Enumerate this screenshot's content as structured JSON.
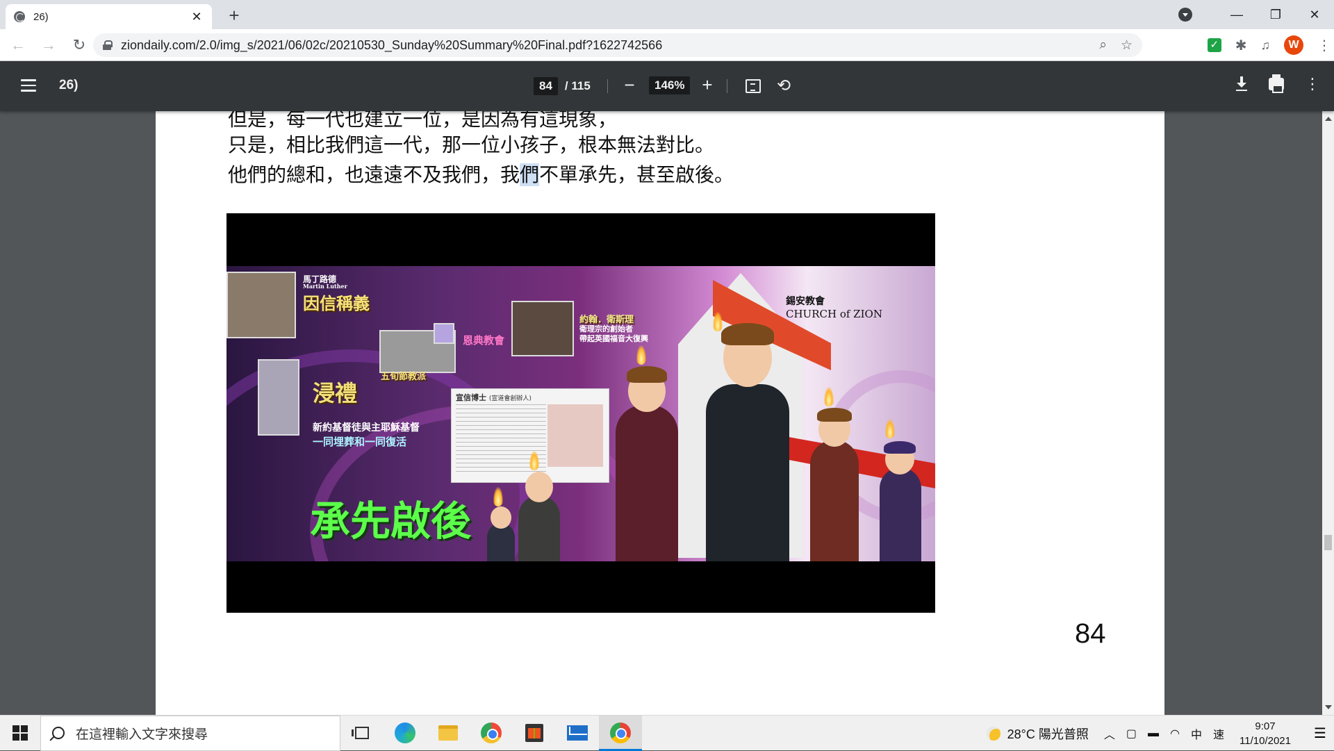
{
  "browser": {
    "tab_title": "26)",
    "url": "ziondaily.com/2.0/img_s/2021/06/02c/20210530_Sunday%20Summary%20Final.pdf?1622742566",
    "avatar_letter": "W"
  },
  "pdf": {
    "doc_title": "26)",
    "current_page": "84",
    "total_pages": "/ 115",
    "zoom": "146%"
  },
  "page": {
    "line1": "但是，每一代也建立一位，是因為有這現象，",
    "line2": "只是，相比我們這一代，那一位小孩子，根本無法對比。",
    "line3_before": "他們的總和，也遠遠不及我們，我",
    "line3_highlight": "們",
    "line3_after": "不單承先，甚至啟後。",
    "page_number": "84"
  },
  "slide": {
    "luther_name": "馬丁路德",
    "luther_en": "Martin Luther",
    "justification": "因信稱義",
    "grace_church": "恩典教會",
    "pentecostal": "五旬節教派",
    "baptism": "浸禮",
    "baptism_caption1": "新約基督徒與主耶穌基督",
    "baptism_caption2": "一同埋葬和一同復活",
    "wesley_name": "約翰．衛斯理",
    "wesley_line1": "衛理宗的創始者",
    "wesley_line2": "帶起英國福音大復興",
    "simpson_head": "宣信博士",
    "simpson_head_sub": "(宣道會創辦人)",
    "motto": "承先啟後",
    "logo_zh": "錫安教會",
    "logo_en": "CHURCH of ZION"
  },
  "taskbar": {
    "search_placeholder": "在這裡輸入文字來搜尋",
    "weather": "28°C 陽光普照",
    "ime": "中",
    "ime2": "速",
    "time": "9:07",
    "date": "11/10/2021"
  }
}
